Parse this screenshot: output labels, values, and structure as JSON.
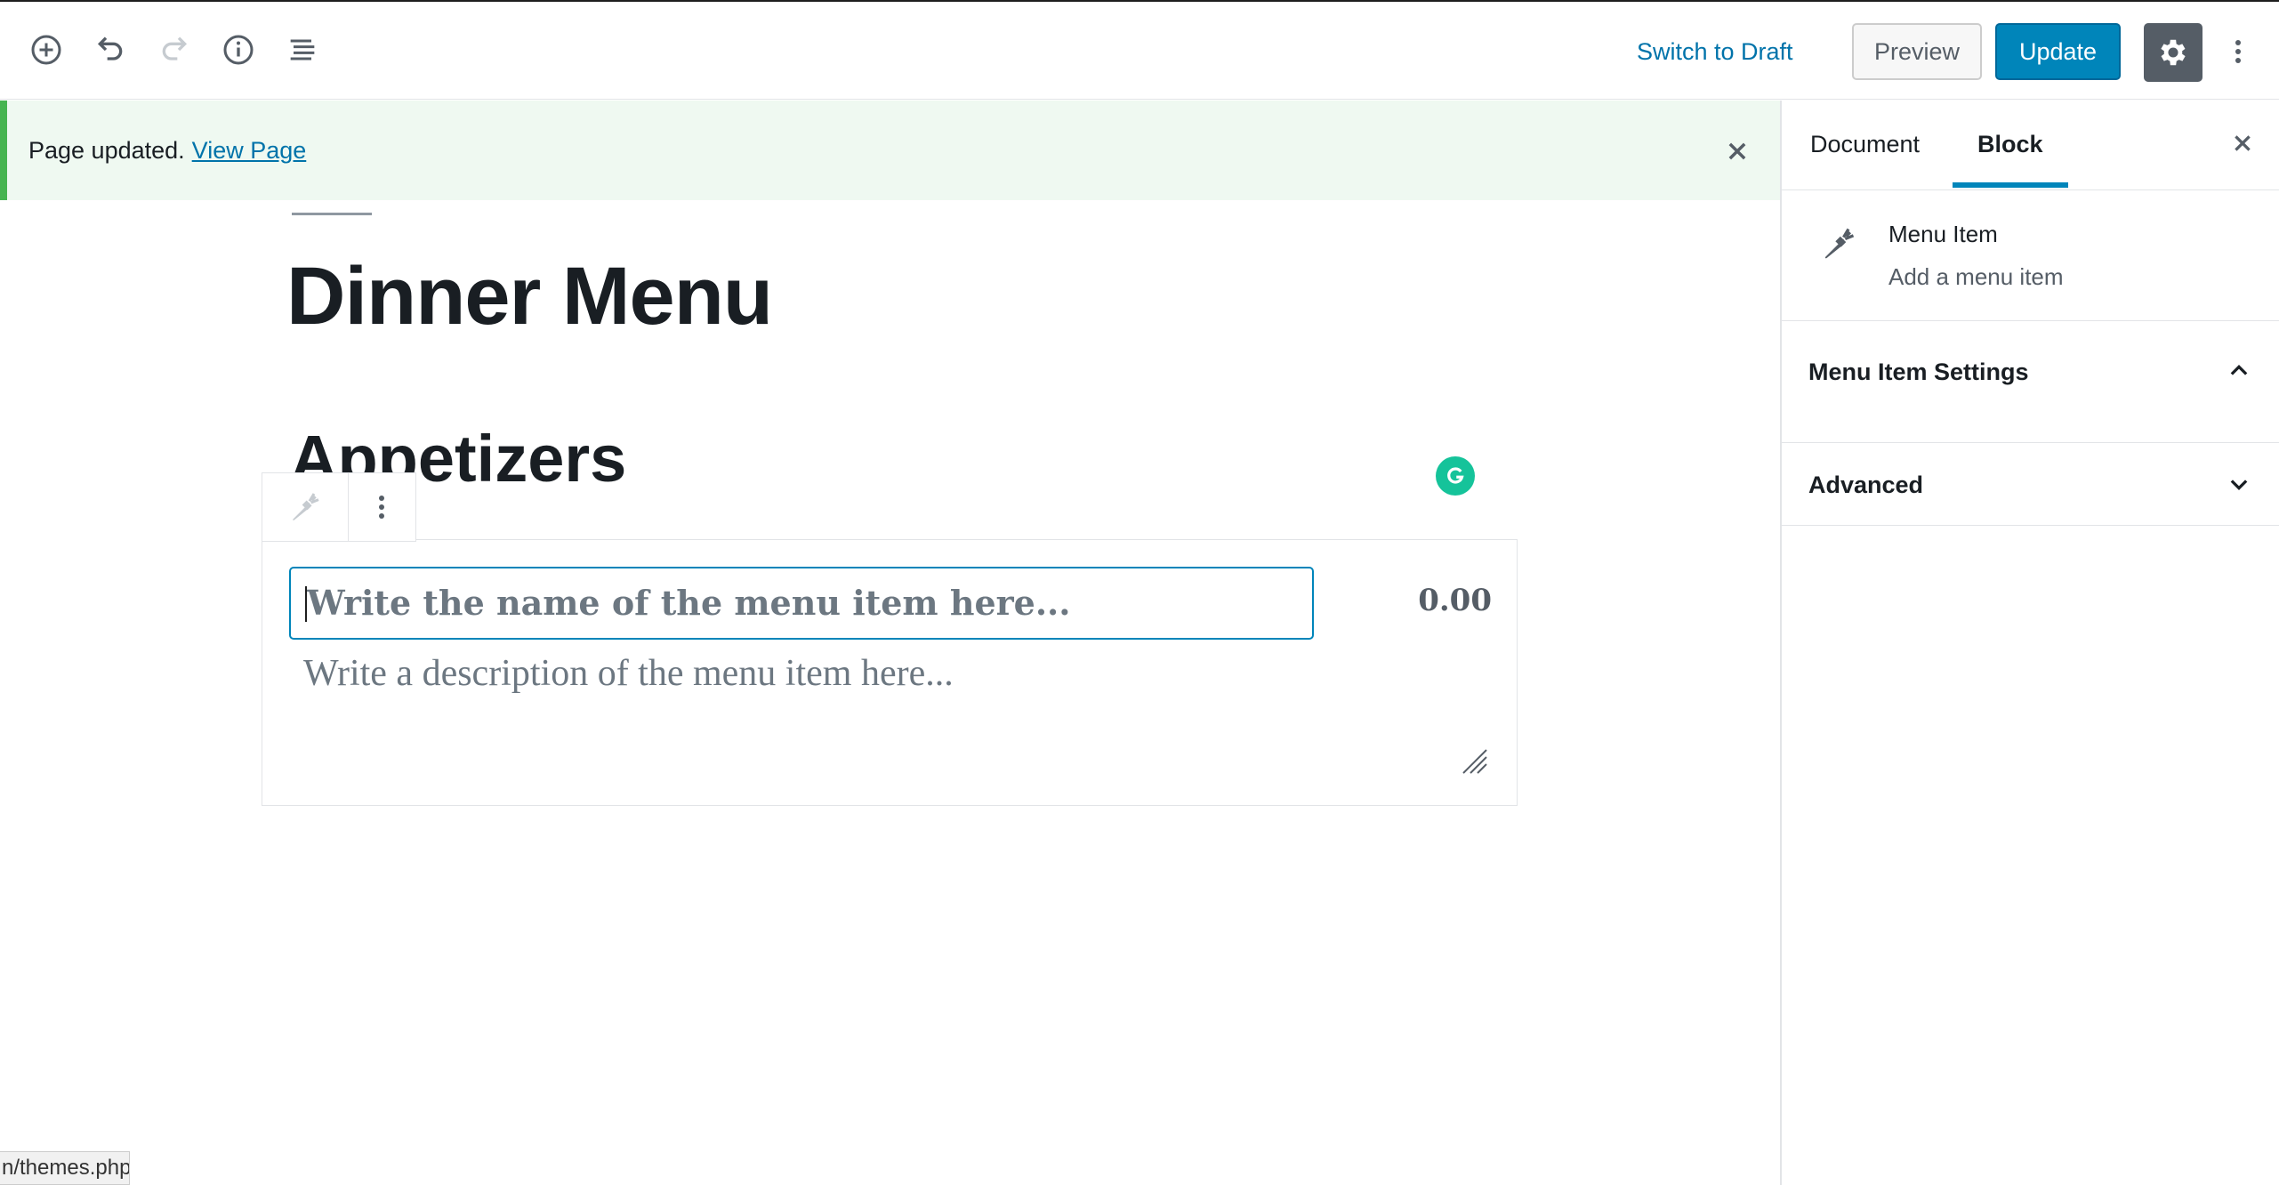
{
  "toolbar": {
    "add_block_icon": "plus-circle-icon",
    "undo_icon": "undo-icon",
    "redo_icon": "redo-icon",
    "info_icon": "info-icon",
    "outline_icon": "list-icon",
    "switch_to_draft": "Switch to Draft",
    "preview": "Preview",
    "update": "Update",
    "settings_icon": "gear-icon",
    "more_icon": "vertical-ellipsis-icon"
  },
  "notice": {
    "text": "Page updated.",
    "link": "View Page"
  },
  "editor": {
    "title": "Dinner Menu",
    "heading": "Appetizers",
    "menu_item": {
      "name_placeholder": "Write the name of the menu item here...",
      "price": "0.00",
      "description_placeholder": "Write a description of the menu item here..."
    }
  },
  "status_bar": {
    "url": "n/themes.php"
  },
  "sidebar": {
    "tabs": [
      {
        "label": "Document",
        "active": false
      },
      {
        "label": "Block",
        "active": true
      }
    ],
    "block_card": {
      "title": "Menu Item",
      "description": "Add a menu item",
      "icon": "carrot-icon"
    },
    "panels": [
      {
        "title": "Menu Item Settings",
        "expanded": true
      },
      {
        "title": "Advanced",
        "expanded": false
      }
    ]
  },
  "colors": {
    "accent": "#0085ba",
    "link": "#0073aa",
    "notice_border": "#46b450",
    "notice_bg": "#eff9f1",
    "grammarly": "#15c39a"
  }
}
